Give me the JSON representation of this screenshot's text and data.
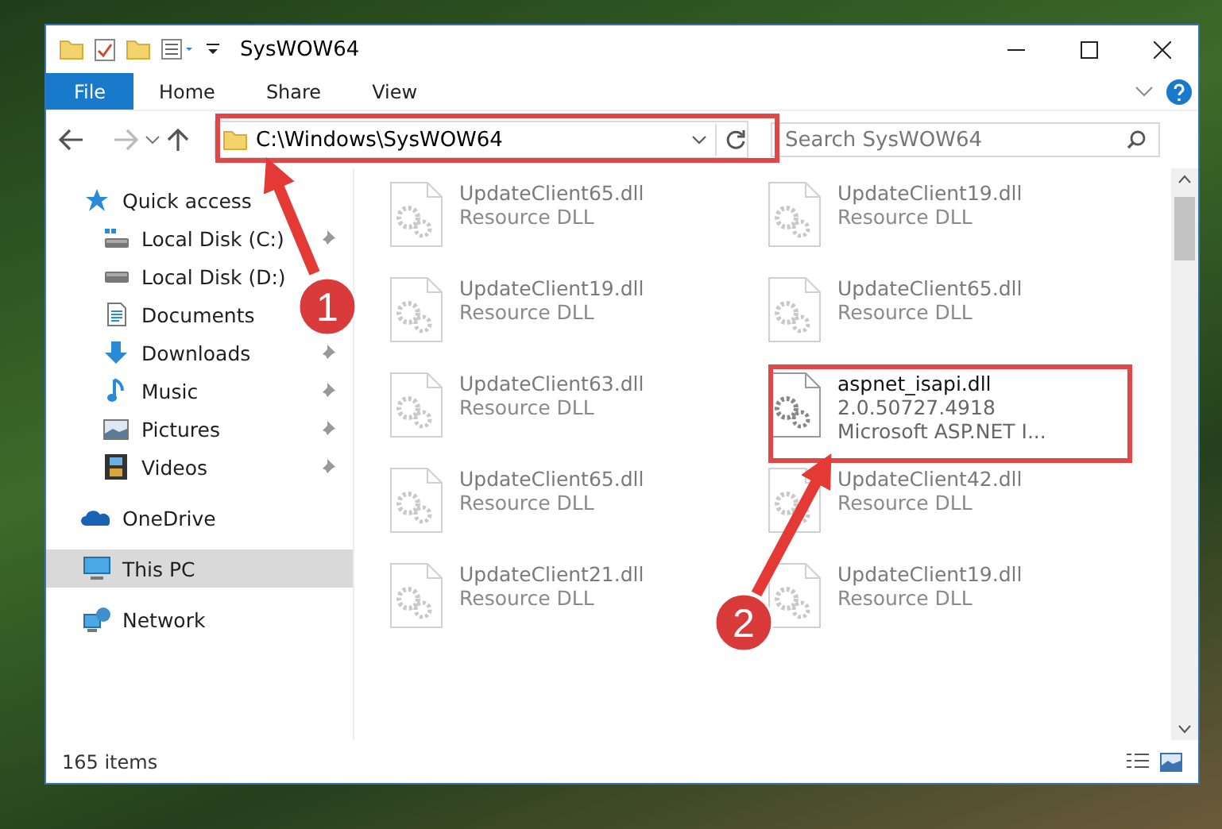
{
  "window": {
    "title": "SysWOW64",
    "address": "C:\\Windows\\SysWOW64",
    "search_placeholder": "Search SysWOW64"
  },
  "ribbon_tabs": [
    {
      "label": "File",
      "kind": "file"
    },
    {
      "label": "Home",
      "kind": "tab"
    },
    {
      "label": "Share",
      "kind": "tab"
    },
    {
      "label": "View",
      "kind": "tab"
    }
  ],
  "nav": [
    {
      "label": "Quick access",
      "kind": "star",
      "selected": false,
      "children": [
        {
          "label": "Local Disk (C:)",
          "kind": "drive-c",
          "selected": false,
          "pinned": true
        },
        {
          "label": "Local Disk (D:)",
          "kind": "drive",
          "selected": false
        },
        {
          "label": "Documents",
          "kind": "documents",
          "selected": false
        },
        {
          "label": "Downloads",
          "kind": "downloads",
          "selected": false,
          "pinned": true
        },
        {
          "label": "Music",
          "kind": "music",
          "selected": false,
          "pinned": true
        },
        {
          "label": "Pictures",
          "kind": "pictures",
          "selected": false,
          "pinned": true
        },
        {
          "label": "Videos",
          "kind": "videos",
          "selected": false,
          "pinned": true
        }
      ]
    },
    {
      "label": "OneDrive",
      "kind": "cloud",
      "selected": false
    },
    {
      "label": "This PC",
      "kind": "pc",
      "selected": true
    },
    {
      "label": "Network",
      "kind": "network",
      "selected": false
    }
  ],
  "files": [
    {
      "lines": [
        "UpdateClient65.dll",
        "Resource DLL"
      ],
      "faded": true
    },
    {
      "lines": [
        "UpdateClient19.dll",
        "Resource DLL"
      ],
      "faded": true
    },
    {
      "lines": [
        "UpdateClient19.dll",
        "Resource DLL"
      ],
      "faded": true
    },
    {
      "lines": [
        "UpdateClient65.dll",
        "Resource DLL"
      ],
      "faded": true
    },
    {
      "lines": [
        "UpdateClient63.dll",
        "Resource DLL"
      ],
      "faded": true
    },
    {
      "lines": [
        "aspnet_isapi.dll",
        "2.0.50727.4918",
        "Microsoft ASP.NET I..."
      ],
      "faded": false
    },
    {
      "lines": [
        "UpdateClient65.dll",
        "Resource DLL"
      ],
      "faded": true
    },
    {
      "lines": [
        "UpdateClient42.dll",
        "Resource DLL"
      ],
      "faded": true
    },
    {
      "lines": [
        "UpdateClient21.dll",
        "Resource DLL"
      ],
      "faded": true
    },
    {
      "lines": [
        "UpdateClient19.dll",
        "Resource DLL"
      ],
      "faded": true
    }
  ],
  "status_bar": {
    "item_count": "165 items"
  },
  "annotations": [
    {
      "number": "1"
    },
    {
      "number": "2"
    }
  ]
}
